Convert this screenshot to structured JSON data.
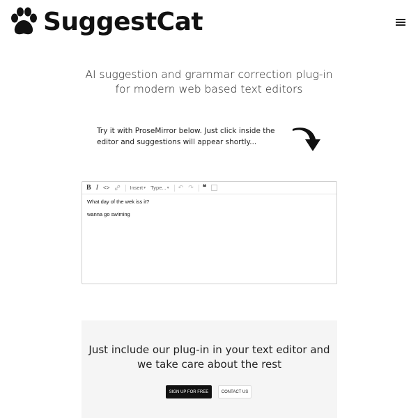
{
  "header": {
    "brand": "SuggestCat",
    "menu_icon": "hamburger-menu-icon",
    "logo_icon": "paw-icon"
  },
  "hero": {
    "tagline_line1": "AI suggestion and grammar correction plug-in",
    "tagline_line2": "for modern web based text editors",
    "try_text": "Try it with ProseMirror below. Just click inside the editor and suggestions will appear shortly...",
    "arrow_icon": "curved-arrow-down-icon"
  },
  "editor": {
    "toolbar": {
      "bold": "B",
      "italic": "I",
      "code": "<>",
      "link_icon": "link-icon",
      "insert": "Insert",
      "type": "Type...",
      "undo_icon": "undo-icon",
      "redo_icon": "redo-icon",
      "quote": "❝",
      "block_icon": "select-parent-icon"
    },
    "lines": [
      "What day of the wek iss it?",
      "wanna go swiming"
    ]
  },
  "cta": {
    "heading_line1": "Just include our plug-in in your text editor and",
    "heading_line2": "we take care about the rest",
    "signup": "SIGN UP FOR FREE",
    "contact": "CONTACT US"
  },
  "colors": {
    "text": "#111111",
    "cta_background": "#f5f5f5",
    "primary_button": "#111111"
  }
}
